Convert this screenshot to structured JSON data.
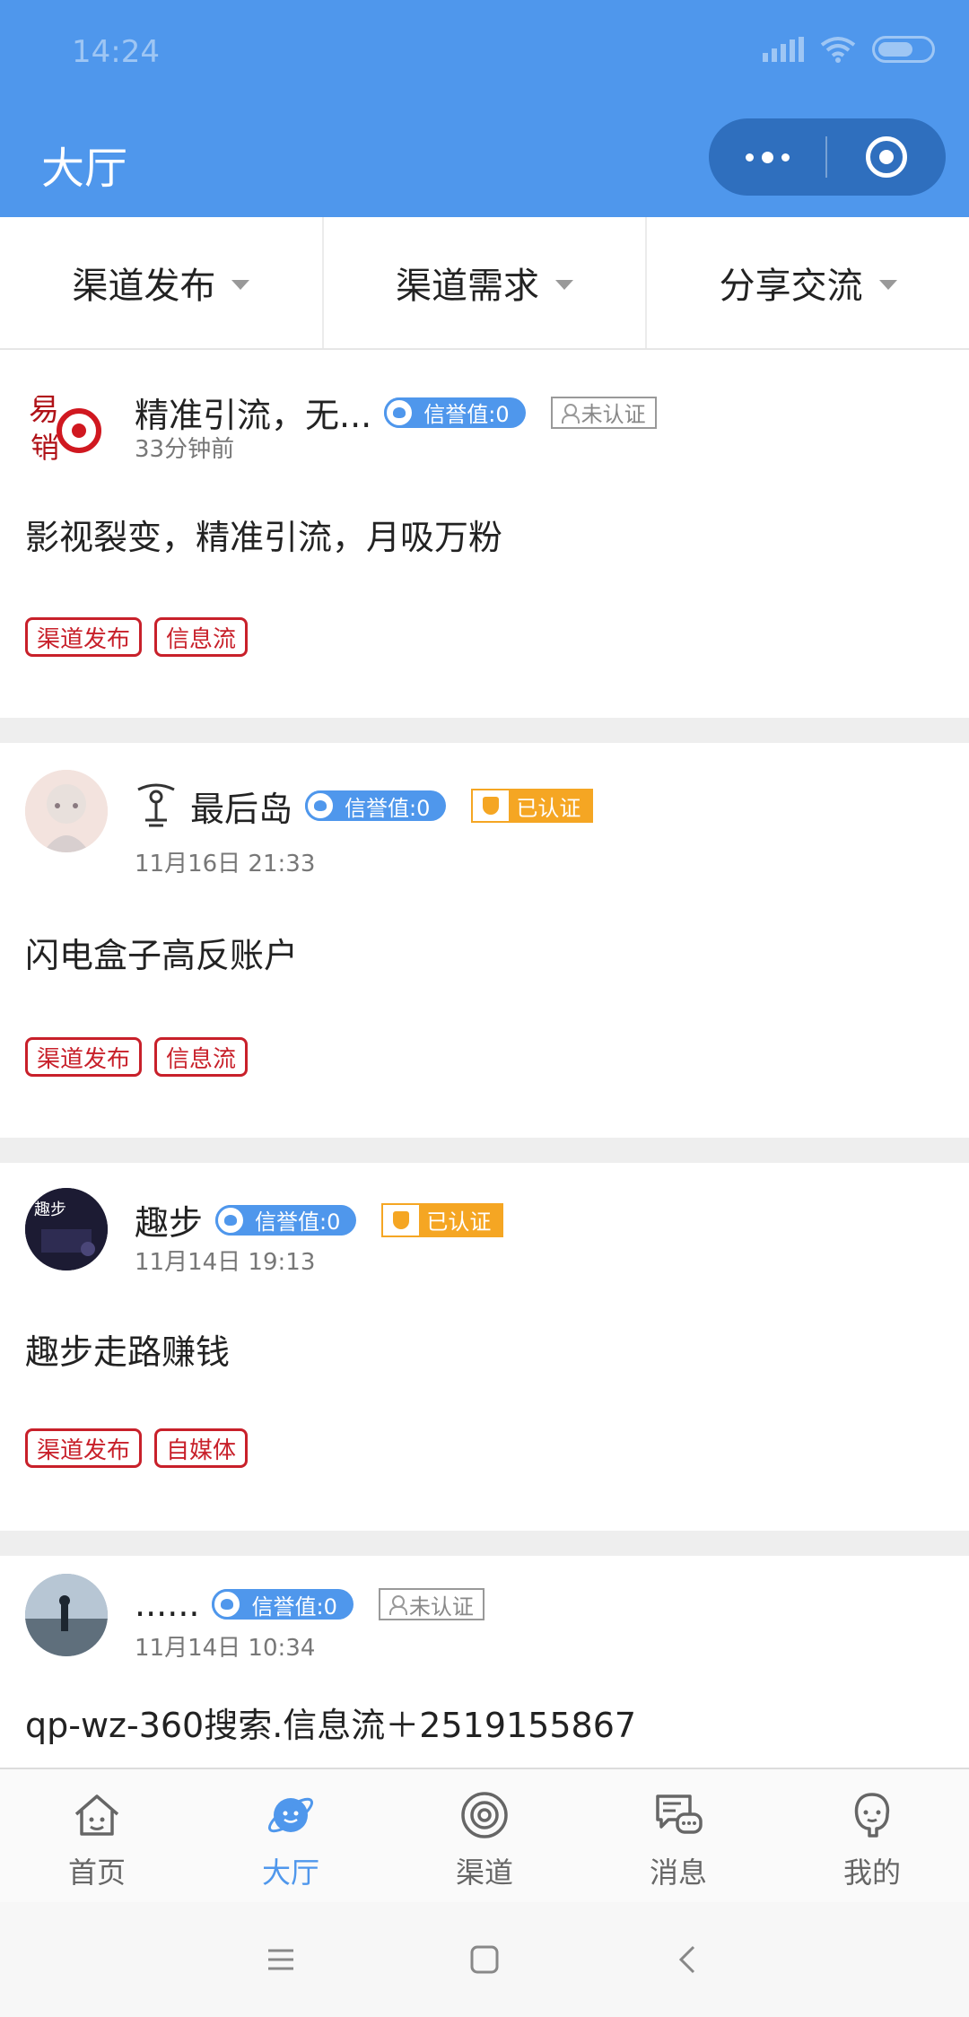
{
  "status": {
    "time": "14:24"
  },
  "header": {
    "title": "大厅"
  },
  "filters": [
    {
      "label": "渠道发布"
    },
    {
      "label": "渠道需求"
    },
    {
      "label": "分享交流"
    }
  ],
  "posts": [
    {
      "name": "精准引流，无...",
      "credit": "信誉值:0",
      "cert": "未认证",
      "time": "33分钟前",
      "content": "影视裂变，精准引流，月吸万粉",
      "tags": [
        "渠道发布",
        "信息流"
      ]
    },
    {
      "name": "最后岛",
      "credit": "信誉值:0",
      "cert": "已认证",
      "time": "11月16日 21:33",
      "content": "闪电盒子高反账户",
      "tags": [
        "渠道发布",
        "信息流"
      ]
    },
    {
      "name": "趣步",
      "credit": "信誉值:0",
      "cert": "已认证",
      "time": "11月14日 19:13",
      "content": "趣步走路赚钱",
      "tags": [
        "渠道发布",
        "自媒体"
      ]
    },
    {
      "name": "......",
      "credit": "信誉值:0",
      "cert": "未认证",
      "time": "11月14日 10:34",
      "content": "qp-wz-360搜索.信息流＋2519155867",
      "tags": []
    }
  ],
  "tabbar": [
    {
      "label": "首页",
      "icon": "home-icon"
    },
    {
      "label": "大厅",
      "icon": "planet-icon",
      "active": true
    },
    {
      "label": "渠道",
      "icon": "target-icon"
    },
    {
      "label": "消息",
      "icon": "chat-icon"
    },
    {
      "label": "我的",
      "icon": "user-icon"
    }
  ],
  "colors": {
    "brand": "#4f97ec",
    "tag_red": "#c8202a",
    "cert_orange": "#f5a623"
  }
}
